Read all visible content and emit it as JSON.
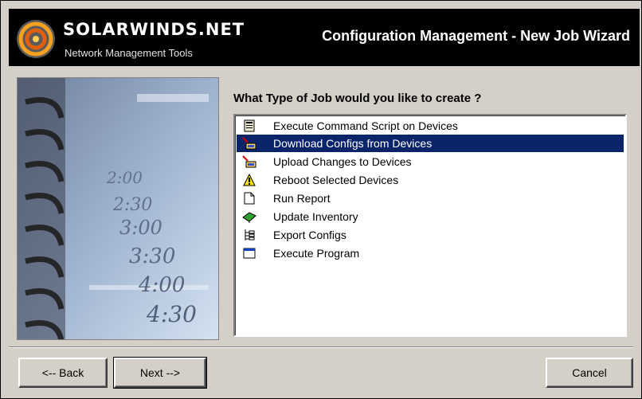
{
  "header": {
    "brand": "SOLARWINDS.NET",
    "tagline": "Network Management Tools",
    "title": "Configuration Management - New Job Wizard"
  },
  "side_image": {
    "clock_labels": [
      "2:00",
      "2:30",
      "3:00",
      "3:30",
      "4:00",
      "4:30"
    ]
  },
  "question": "What Type of Job would you like to create ?",
  "job_types": [
    {
      "label": "Execute Command Script on Devices",
      "icon": "script-icon",
      "selected": false
    },
    {
      "label": "Download Configs from Devices",
      "icon": "download-icon",
      "selected": true
    },
    {
      "label": "Upload Changes to Devices",
      "icon": "upload-icon",
      "selected": false
    },
    {
      "label": "Reboot Selected Devices",
      "icon": "warning-icon",
      "selected": false
    },
    {
      "label": "Run Report",
      "icon": "report-icon",
      "selected": false
    },
    {
      "label": "Update Inventory",
      "icon": "inventory-icon",
      "selected": false
    },
    {
      "label": "Export Configs",
      "icon": "export-icon",
      "selected": false
    },
    {
      "label": "Execute Program",
      "icon": "program-icon",
      "selected": false
    }
  ],
  "buttons": {
    "back": "<-- Back",
    "next": "Next -->",
    "cancel": "Cancel"
  },
  "colors": {
    "selection": "#0a246a",
    "dialog_bg": "#d4d0c8",
    "header_bg": "#000000"
  }
}
